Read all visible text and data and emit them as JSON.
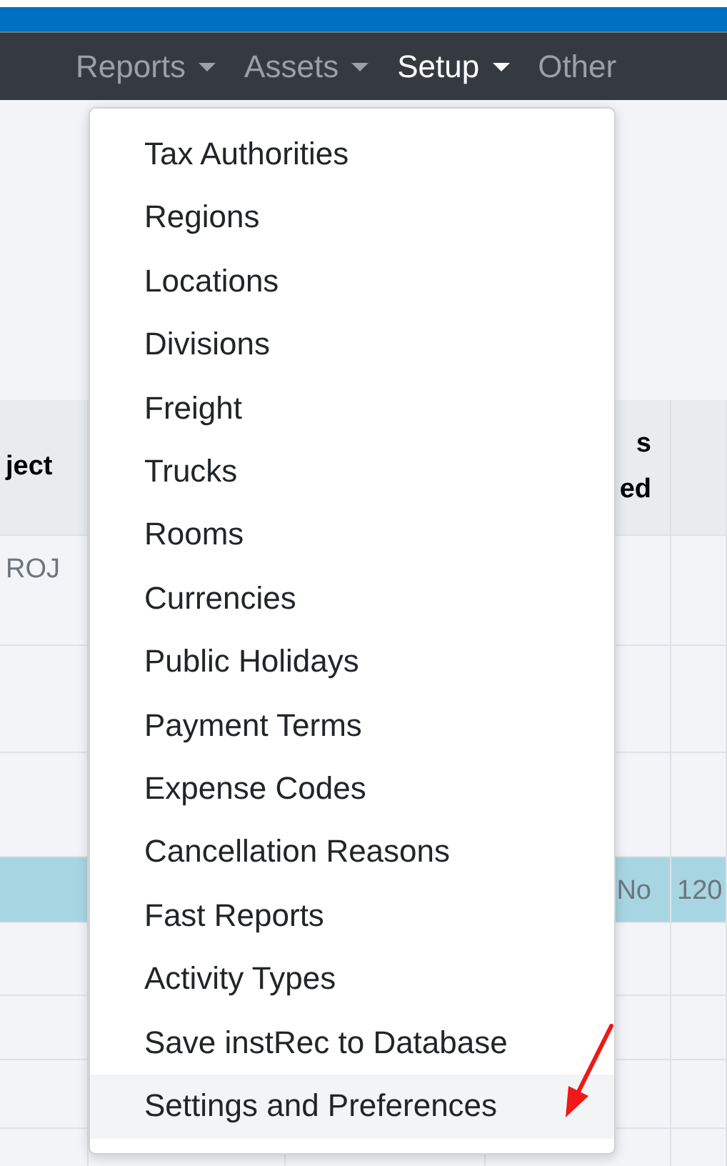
{
  "navbar": {
    "items": [
      {
        "label": "Reports",
        "selected": false,
        "caret": true
      },
      {
        "label": "Assets",
        "selected": false,
        "caret": true
      },
      {
        "label": "Setup",
        "selected": true,
        "caret": true
      },
      {
        "label": "Other",
        "selected": false,
        "caret": false
      }
    ]
  },
  "table": {
    "headers": {
      "column_1": [
        "ject"
      ],
      "column_4": [
        "s",
        "ed"
      ]
    },
    "rows": [
      {
        "selected": false,
        "cells": {
          "column_1": "ROJ"
        }
      },
      {
        "selected": false,
        "cells": {}
      },
      {
        "selected": false,
        "cells": {}
      },
      {
        "selected": true,
        "cells": {
          "column_4": "No",
          "column_5": "120"
        }
      },
      {
        "selected": false,
        "cells": {}
      },
      {
        "selected": false,
        "cells": {}
      },
      {
        "selected": false,
        "cells": {}
      },
      {
        "selected": false,
        "cells": {}
      }
    ]
  },
  "dropdown": {
    "items": [
      {
        "label": "Tax Authorities",
        "highlighted": false
      },
      {
        "label": "Regions",
        "highlighted": false
      },
      {
        "label": "Locations",
        "highlighted": false
      },
      {
        "label": "Divisions",
        "highlighted": false
      },
      {
        "label": "Freight",
        "highlighted": false
      },
      {
        "label": "Trucks",
        "highlighted": false
      },
      {
        "label": "Rooms",
        "highlighted": false
      },
      {
        "label": "Currencies",
        "highlighted": false
      },
      {
        "label": "Public Holidays",
        "highlighted": false
      },
      {
        "label": "Payment Terms",
        "highlighted": false
      },
      {
        "label": "Expense Codes",
        "highlighted": false
      },
      {
        "label": "Cancellation Reasons",
        "highlighted": false
      },
      {
        "label": "Fast Reports",
        "highlighted": false
      },
      {
        "label": "Activity Types",
        "highlighted": false
      },
      {
        "label": "Save instRec to Database",
        "highlighted": false
      },
      {
        "label": "Settings and Preferences",
        "highlighted": true
      }
    ]
  },
  "annotation": {
    "kind": "arrow"
  }
}
